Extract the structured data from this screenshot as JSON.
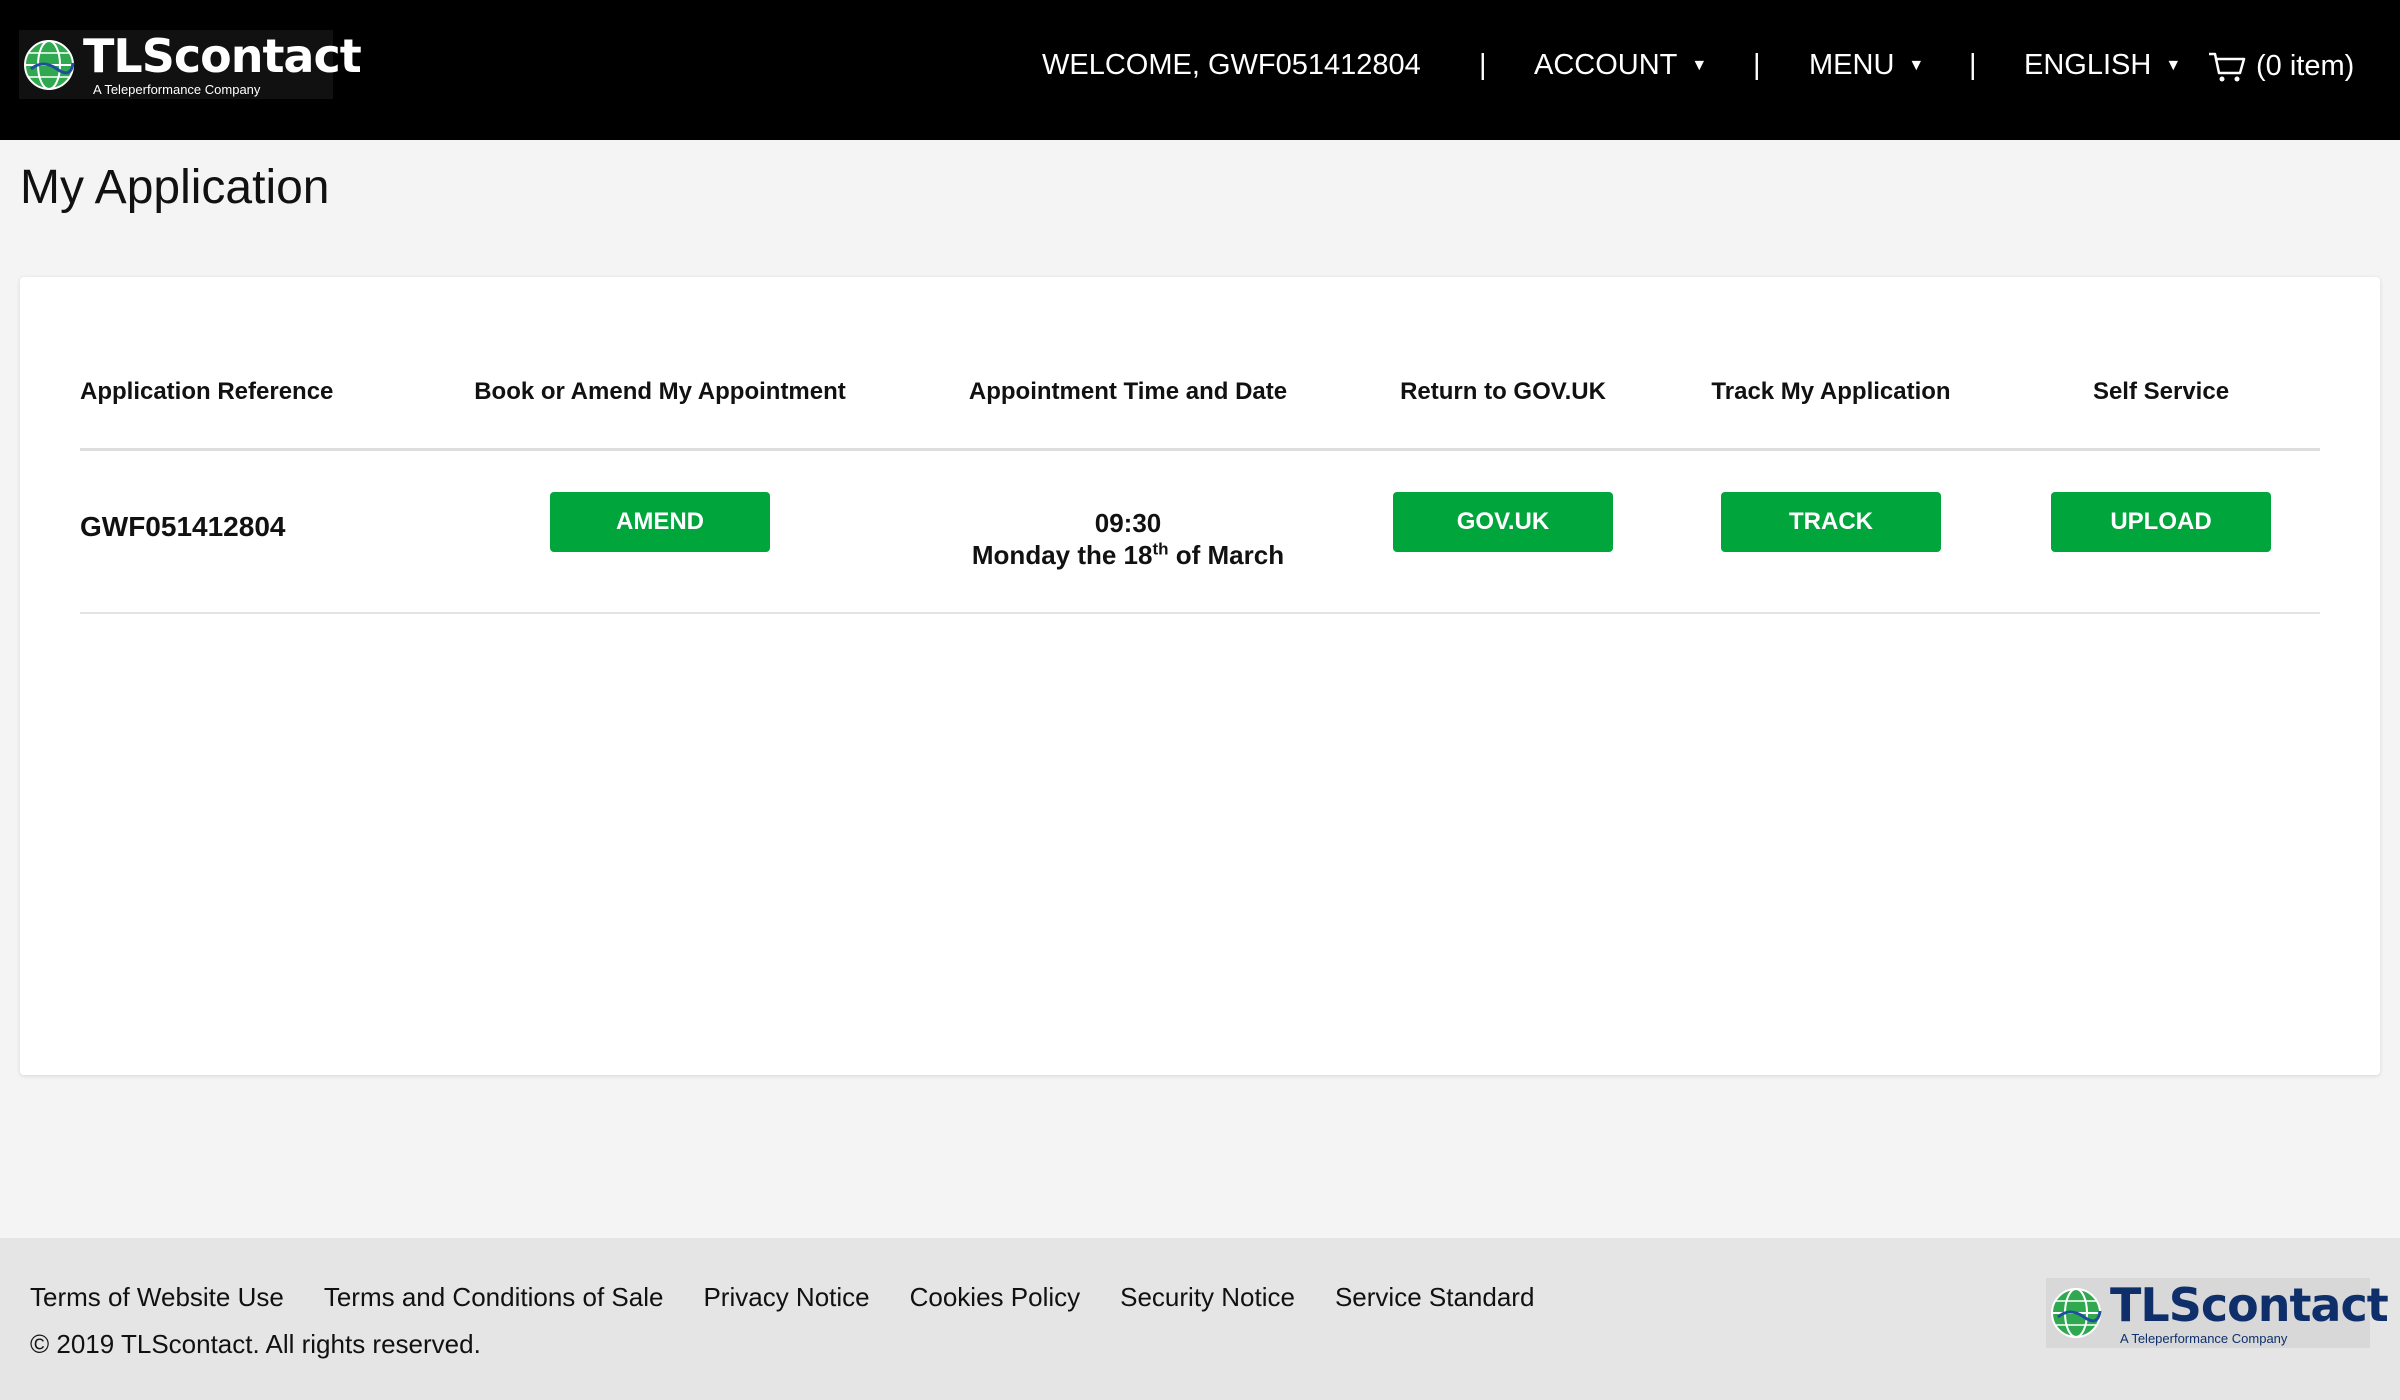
{
  "header": {
    "logo_name": "TLScontact",
    "logo_tagline": "A Teleperformance Company",
    "welcome": "WELCOME, GWF051412804",
    "separator": "|",
    "account": "ACCOUNT",
    "menu": "MENU",
    "language": "ENGLISH",
    "cart": "(0 item)"
  },
  "page": {
    "title": "My Application"
  },
  "table": {
    "headers": [
      "Application Reference",
      "Book or Amend My Appointment",
      "Appointment Time and Date",
      "Return to GOV.UK",
      "Track My Application",
      "Self Service"
    ],
    "row": {
      "reference": "GWF051412804",
      "amend_label": "AMEND",
      "appointment_time": "09:30",
      "appointment_date_prefix": "Monday the 18",
      "appointment_date_ordinal": "th",
      "appointment_date_suffix": " of March",
      "govuk_label": "GOV.UK",
      "track_label": "TRACK",
      "upload_label": "UPLOAD"
    }
  },
  "footer": {
    "links": [
      "Terms of Website Use",
      "Terms and Conditions of Sale",
      "Privacy Notice",
      "Cookies Policy",
      "Security Notice",
      "Service Standard"
    ],
    "copyright": "© 2019 TLScontact. All rights reserved.",
    "logo_name": "TLScontact",
    "logo_tagline": "A Teleperformance Company"
  },
  "colors": {
    "header_bg": "#000000",
    "button_green": "#00a53c",
    "footer_bg": "#e5e5e5",
    "page_bg": "#f4f4f4"
  }
}
